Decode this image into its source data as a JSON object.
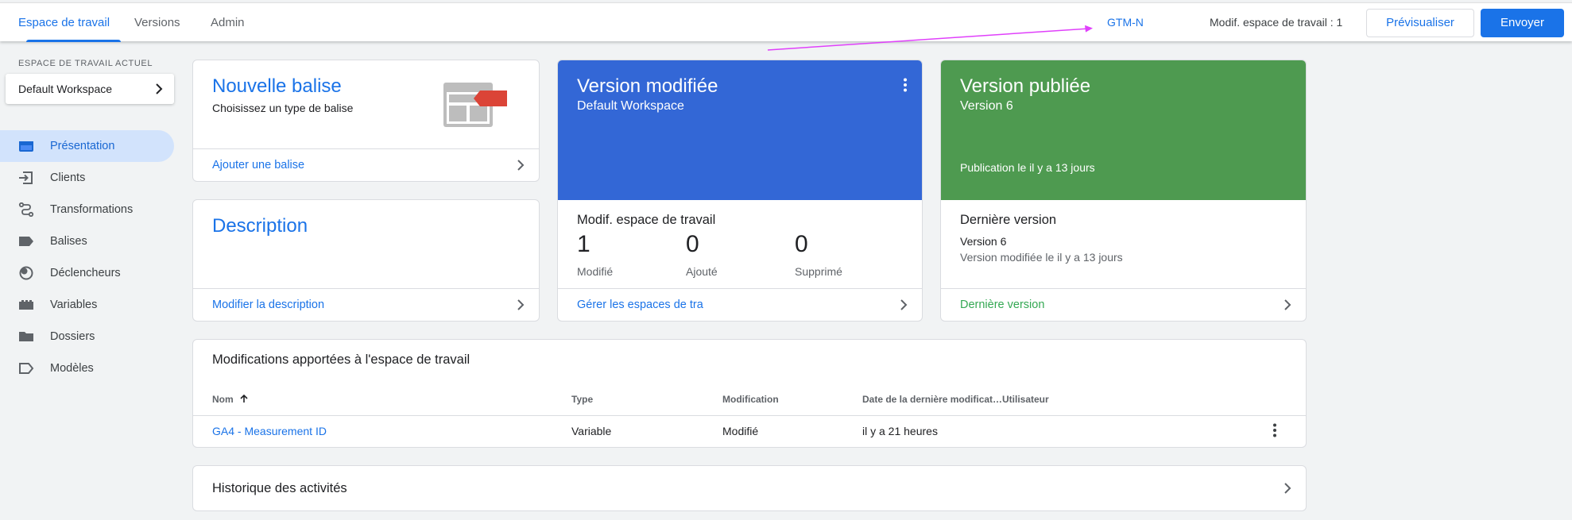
{
  "header": {
    "tabs": [
      {
        "label": "Espace de travail",
        "active": true
      },
      {
        "label": "Versions",
        "active": false
      },
      {
        "label": "Admin",
        "active": false
      }
    ],
    "container_id": "GTM-N",
    "workspace_changes": "Modif. espace de travail : 1",
    "preview_label": "Prévisualiser",
    "submit_label": "Envoyer"
  },
  "sidebar": {
    "workspace_label": "ESPACE DE TRAVAIL ACTUEL",
    "workspace_name": "Default Workspace",
    "items": [
      {
        "label": "Présentation",
        "icon": "overview-icon",
        "active": true
      },
      {
        "label": "Clients",
        "icon": "clients-icon",
        "active": false
      },
      {
        "label": "Transformations",
        "icon": "transformations-icon",
        "active": false
      },
      {
        "label": "Balises",
        "icon": "tag-icon",
        "active": false
      },
      {
        "label": "Déclencheurs",
        "icon": "trigger-icon",
        "active": false
      },
      {
        "label": "Variables",
        "icon": "variables-icon",
        "active": false
      },
      {
        "label": "Dossiers",
        "icon": "folder-icon",
        "active": false
      },
      {
        "label": "Modèles",
        "icon": "templates-icon",
        "active": false
      }
    ]
  },
  "new_tag_card": {
    "title": "Nouvelle balise",
    "subtitle": "Choisissez un type de balise",
    "link": "Ajouter une balise"
  },
  "description_card": {
    "title": "Description",
    "link": "Modifier la description"
  },
  "modified_version_card": {
    "title": "Version modifiée",
    "subtitle": "Default Workspace",
    "section_title": "Modif. espace de travail",
    "stats": [
      {
        "value": "1",
        "label": "Modifié"
      },
      {
        "value": "0",
        "label": "Ajouté"
      },
      {
        "value": "0",
        "label": "Supprimé"
      }
    ],
    "link": "Gérer les espaces de tra"
  },
  "published_version_card": {
    "title": "Version publiée",
    "subtitle": "Version 6",
    "published_text": "Publication le il y a 13 jours",
    "section_title": "Dernière version",
    "version": "Version 6",
    "modified_text": "Version modifiée le il y a 13 jours",
    "link": "Dernière version"
  },
  "changes_table": {
    "title": "Modifications apportées à l'espace de travail",
    "columns": [
      "Nom",
      "Type",
      "Modification",
      "Date de la dernière modificat…",
      "Utilisateur"
    ],
    "rows": [
      {
        "name": "GA4 - Measurement ID",
        "type": "Variable",
        "change": "Modifié",
        "date": "il y a 21 heures",
        "user": ""
      }
    ]
  },
  "history": {
    "title": "Historique des activités"
  },
  "colors": {
    "accent": "#1a73e8",
    "modified_card": "#3367d6",
    "published_card": "#4e9a50",
    "annotation_arrow": "#e040fb"
  }
}
